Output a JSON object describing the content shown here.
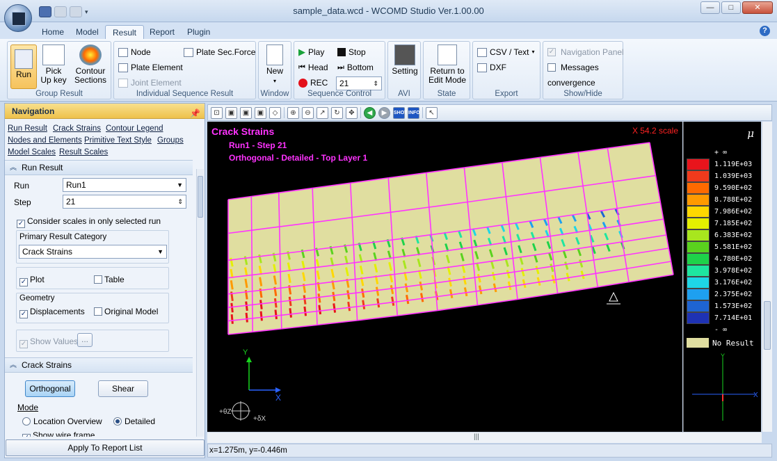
{
  "window": {
    "title": "sample_data.wcd - WCOMD Studio Ver.1.00.00",
    "minimize": "—",
    "maximize": "□",
    "close": "✕"
  },
  "tabs": [
    "Home",
    "Model",
    "Result",
    "Report",
    "Plugin"
  ],
  "ribbon": {
    "group_result": {
      "run": "Run",
      "pickup": "Pick Up key",
      "contour": "Contour Sections",
      "label": "Group Result"
    },
    "individual": {
      "node": "Node",
      "plate_sec_force": "Plate Sec.Force",
      "plate_element": "Plate Element",
      "joint_element": "Joint Element",
      "label": "Individual Sequence Result"
    },
    "window": {
      "new": "New",
      "label": "Window"
    },
    "sequence": {
      "play": "Play",
      "stop": "Stop",
      "head": "Head",
      "bottom": "Bottom",
      "rec": "REC",
      "step_value": "21",
      "label": "Sequence Control"
    },
    "avi": {
      "setting": "Setting",
      "label": "AVI"
    },
    "state": {
      "return": "Return to Edit Mode",
      "label": "State"
    },
    "export": {
      "csv": "CSV / Text",
      "dxf": "DXF",
      "label": "Export"
    },
    "showhide": {
      "navigation_panel": "Navigation Panel",
      "messages": "Messages",
      "convergence": "convergence",
      "label": "Show/Hide"
    }
  },
  "nav": {
    "title": "Navigation",
    "links": [
      "Run Result",
      "Crack Strains",
      "Contour Legend",
      "Nodes and Elements",
      "Primitive Text Style",
      "Groups",
      "Model Scales",
      "Result Scales"
    ],
    "run_result": {
      "header": "Run Result",
      "run_label": "Run",
      "run_value": "Run1",
      "step_label": "Step",
      "step_value": "21",
      "consider_scales": "Consider scales in only selected run",
      "primary_label": "Primary Result Category",
      "primary_value": "Crack Strains",
      "plot": "Plot",
      "table": "Table",
      "geometry_label": "Geometry",
      "displacements": "Displacements",
      "original_model": "Original Model",
      "show_values": "Show Values",
      "ellipsis": "..."
    },
    "crack_strains": {
      "header": "Crack Strains",
      "orthogonal": "Orthogonal",
      "shear": "Shear",
      "mode_label": "Mode",
      "location_overview": "Location Overview",
      "detailed": "Detailed",
      "show_wire_frame": "Show wire frame"
    },
    "apply": "Apply To Report List"
  },
  "viewport": {
    "title": "Crack Strains",
    "subtitle1": "Run1 - Step 21",
    "subtitle2": "Orthogonal - Detailed - Top Layer 1",
    "scale": "X 54.2 scale",
    "axis_x": "X",
    "axis_y": "Y",
    "rot_z": "+θZ",
    "rot_x": "+δX"
  },
  "legend": {
    "unit": "μ",
    "entries": [
      {
        "label": "+ ∞",
        "color": ""
      },
      {
        "label": "1.119E+03",
        "color": "#e8141c"
      },
      {
        "label": "1.039E+03",
        "color": "#f03a1c"
      },
      {
        "label": "9.590E+02",
        "color": "#ff6a00"
      },
      {
        "label": "8.788E+02",
        "color": "#ff9a00"
      },
      {
        "label": "7.986E+02",
        "color": "#ffd800"
      },
      {
        "label": "7.185E+02",
        "color": "#e4f000"
      },
      {
        "label": "6.383E+02",
        "color": "#a8e61e"
      },
      {
        "label": "5.581E+02",
        "color": "#5ad21e"
      },
      {
        "label": "4.780E+02",
        "color": "#1ed24a"
      },
      {
        "label": "3.978E+02",
        "color": "#1ee6a0"
      },
      {
        "label": "3.176E+02",
        "color": "#1ed6e6"
      },
      {
        "label": "2.375E+02",
        "color": "#1ea0f0"
      },
      {
        "label": "1.573E+02",
        "color": "#1e64d2"
      },
      {
        "label": "7.714E+01",
        "color": "#1e32b4"
      },
      {
        "label": "- ∞",
        "color": ""
      }
    ],
    "no_result": "No Result"
  },
  "status": {
    "coords": "x=1.275m, y=-0.446m"
  },
  "colors": {
    "mesh": "#ff33ff",
    "element_fill": "#e0dea0",
    "background": "#000000"
  }
}
